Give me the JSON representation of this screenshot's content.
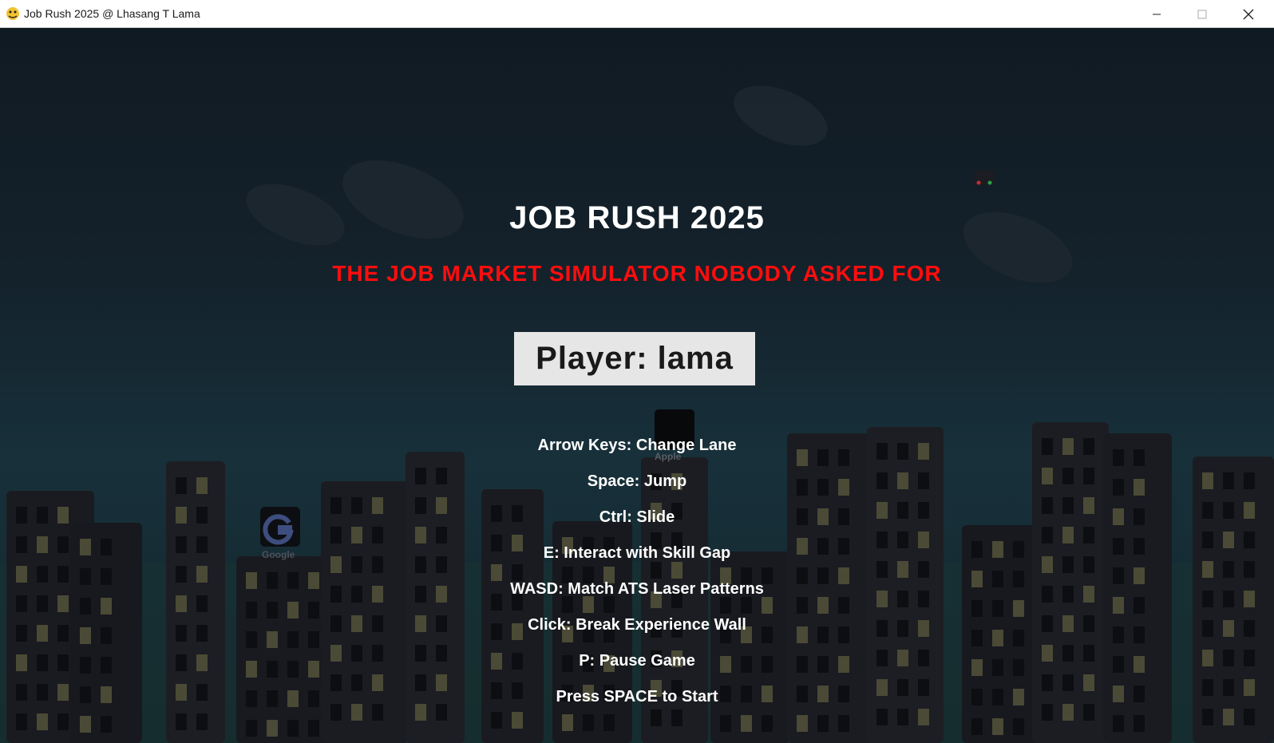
{
  "window": {
    "title": "Job Rush 2025 @ Lhasang T Lama",
    "icon": "pygame-snake-icon",
    "controls": [
      "minimize-icon",
      "maximize-icon",
      "close-icon"
    ]
  },
  "game": {
    "title": "JOB RUSH 2025",
    "tagline": "THE JOB MARKET SIMULATOR NOBODY ASKED FOR",
    "player_label": "Player: lama",
    "controls": [
      "Arrow Keys: Change Lane",
      "Space: Jump",
      "Ctrl: Slide",
      "E: Interact with Skill Gap",
      "WASD: Match ATS Laser Patterns",
      "Click: Break Experience Wall",
      "P: Pause Game",
      "Press SPACE to Start"
    ],
    "obstacles": {
      "apple_label": "Apple",
      "google_label": "Google"
    },
    "colors": {
      "title": "#ffffff",
      "tagline": "#ff0d0d",
      "player_box": "#e6e6e6",
      "building": "#1b1c21",
      "window_lit": "#4a4a36",
      "window_dark": "#0d0e11"
    }
  }
}
